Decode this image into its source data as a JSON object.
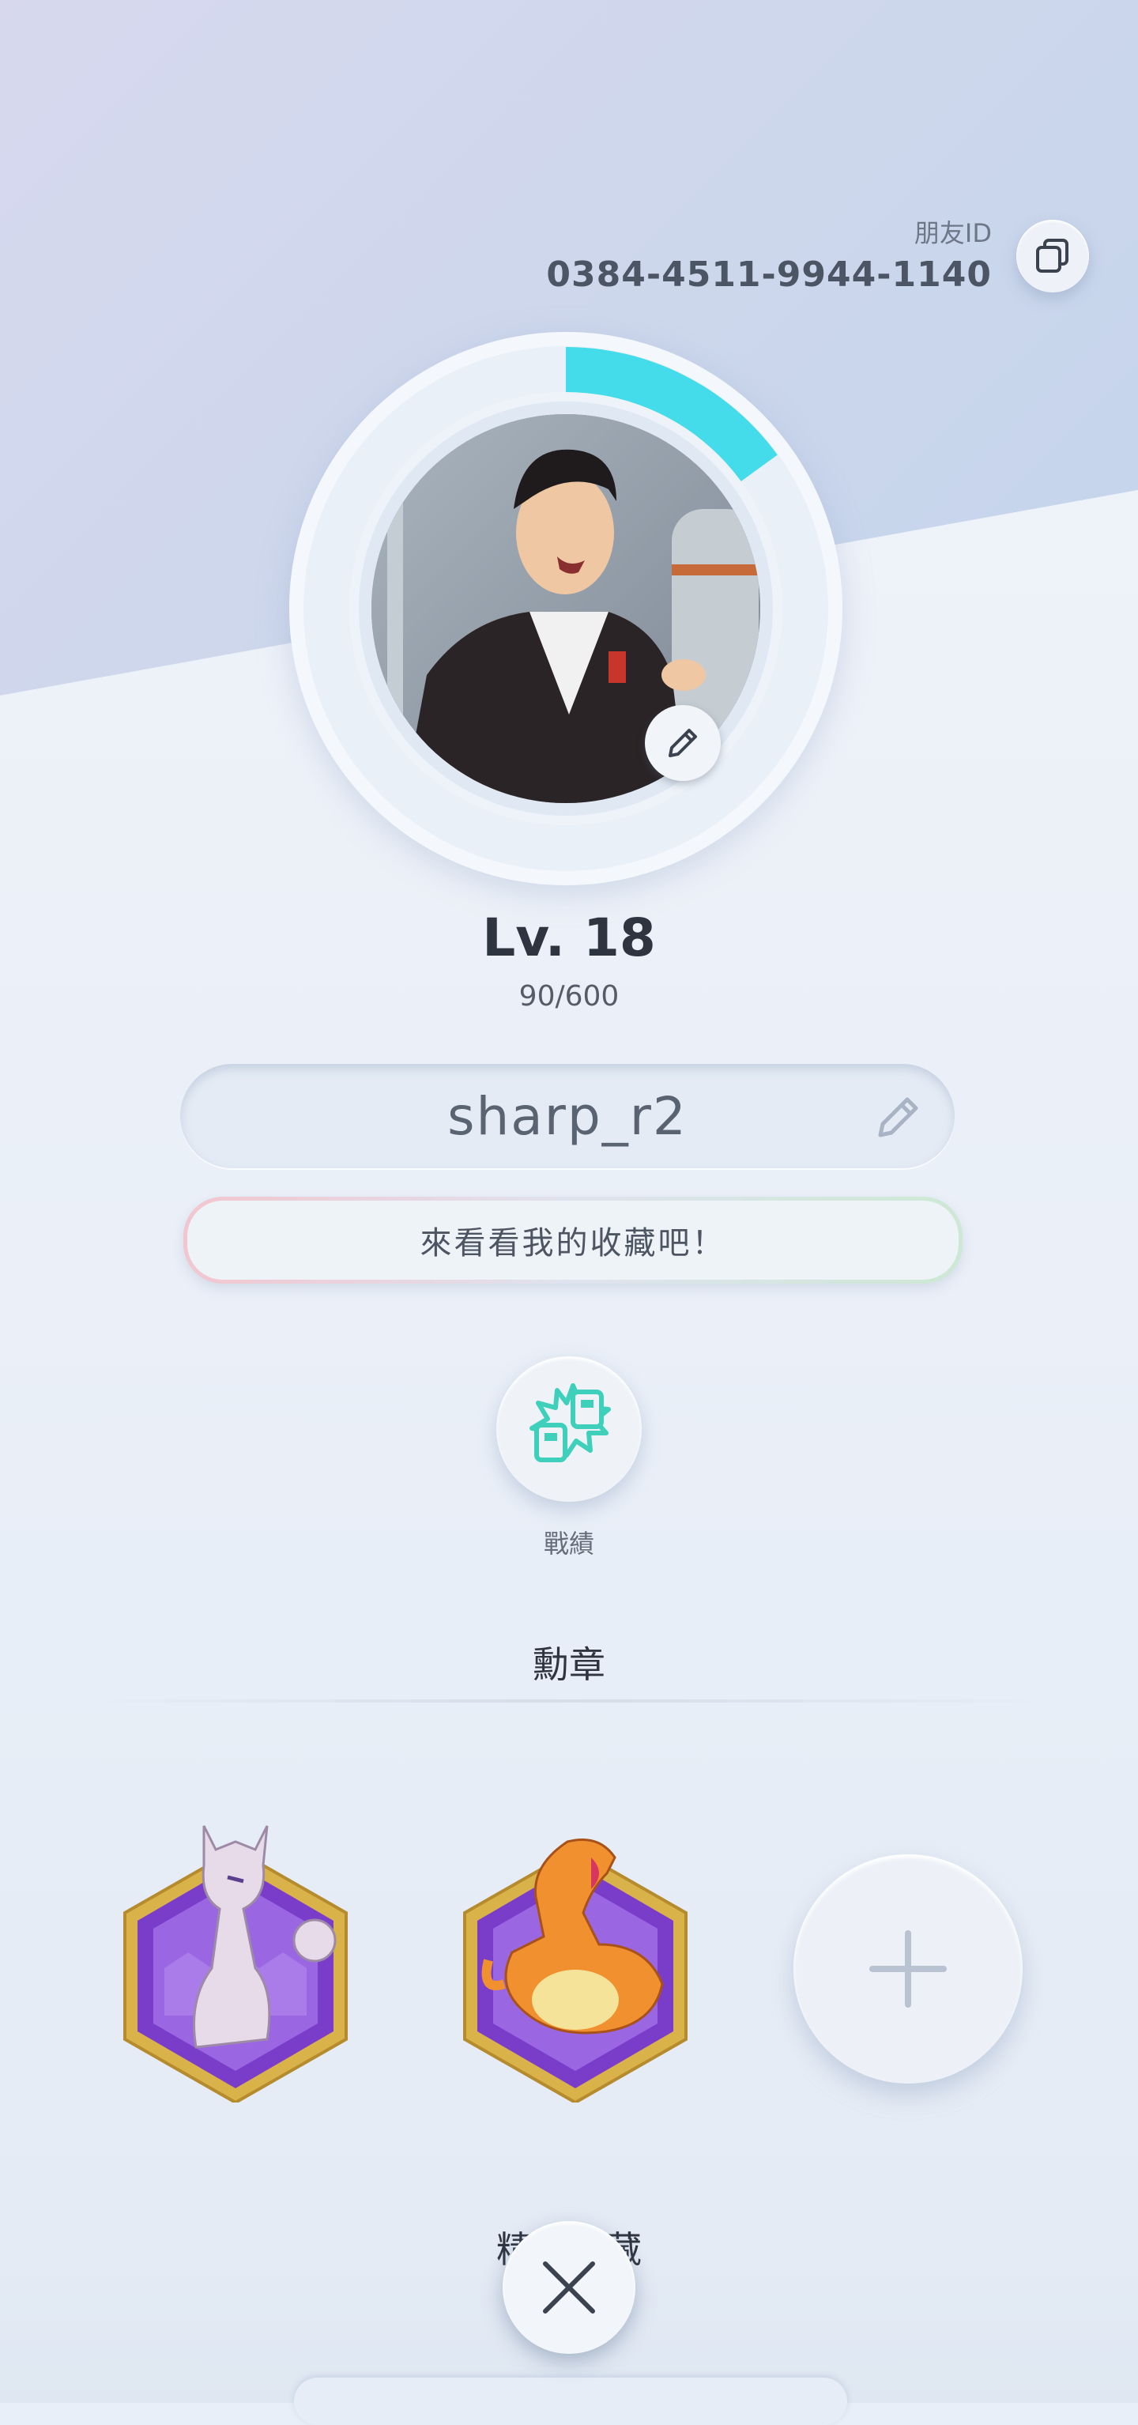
{
  "profile": {
    "friend_id_label": "朋友ID",
    "friend_id": "0384-4511-9944-1140",
    "level": "Lv. 18",
    "exp": "90/600",
    "exp_progress": 0.15,
    "name": "sharp_r2",
    "bio": "來看看我的收藏吧！"
  },
  "actions": {
    "record_label": "戰績"
  },
  "badges": {
    "title": "勳章",
    "items": [
      {
        "name": "Mewtwo badge"
      },
      {
        "name": "Charizard badge"
      }
    ]
  },
  "collection": {
    "title": "精選收藏"
  },
  "colors": {
    "exp_ring": "#44dbea",
    "badge_purple": "#8a4fd8",
    "badge_gold": "#d9b24a",
    "record_icon": "#3fd0bb"
  },
  "icons": [
    "copy-icon",
    "pencil-icon",
    "record-icon",
    "plus-icon",
    "close-icon"
  ]
}
